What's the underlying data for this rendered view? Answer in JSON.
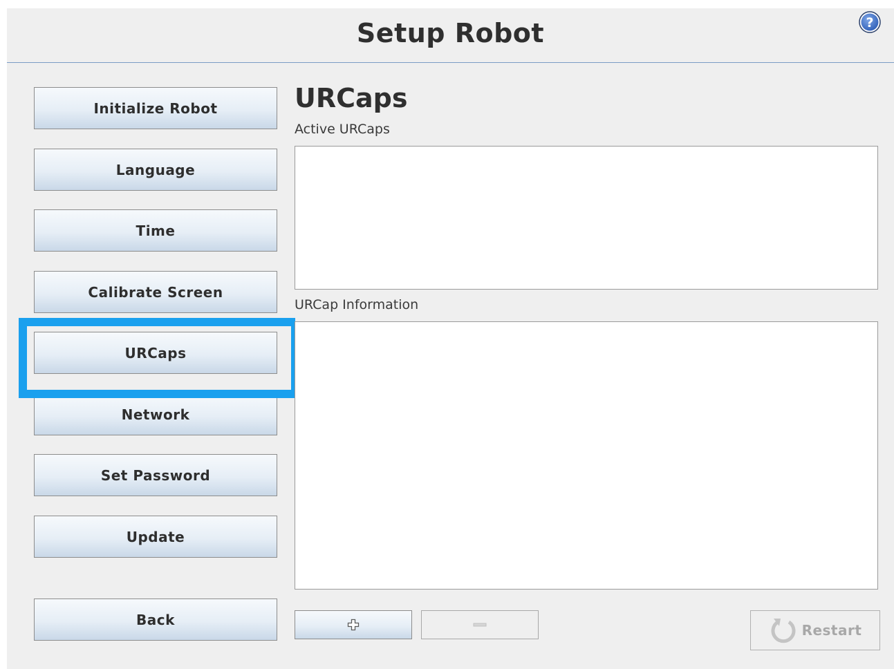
{
  "header": {
    "title": "Setup Robot",
    "help_icon": "question-circle-icon"
  },
  "sidebar": {
    "items": [
      {
        "label": "Initialize Robot"
      },
      {
        "label": "Language"
      },
      {
        "label": "Time"
      },
      {
        "label": "Calibrate Screen"
      },
      {
        "label": "URCaps",
        "selected": true
      },
      {
        "label": "Network"
      },
      {
        "label": "Set Password"
      },
      {
        "label": "Update"
      }
    ],
    "back_label": "Back"
  },
  "main": {
    "title": "URCaps",
    "active_label": "Active URCaps",
    "info_label": "URCap Information",
    "add_icon": "plus-icon",
    "remove_icon": "minus-icon",
    "restart_label": "Restart",
    "restart_icon": "restart-arrow-icon"
  },
  "colors": {
    "highlight": "#1aa0ee",
    "button_gradient_top": "#f6f9fc",
    "button_gradient_bottom": "#c9d8e8",
    "background": "#efefef"
  }
}
